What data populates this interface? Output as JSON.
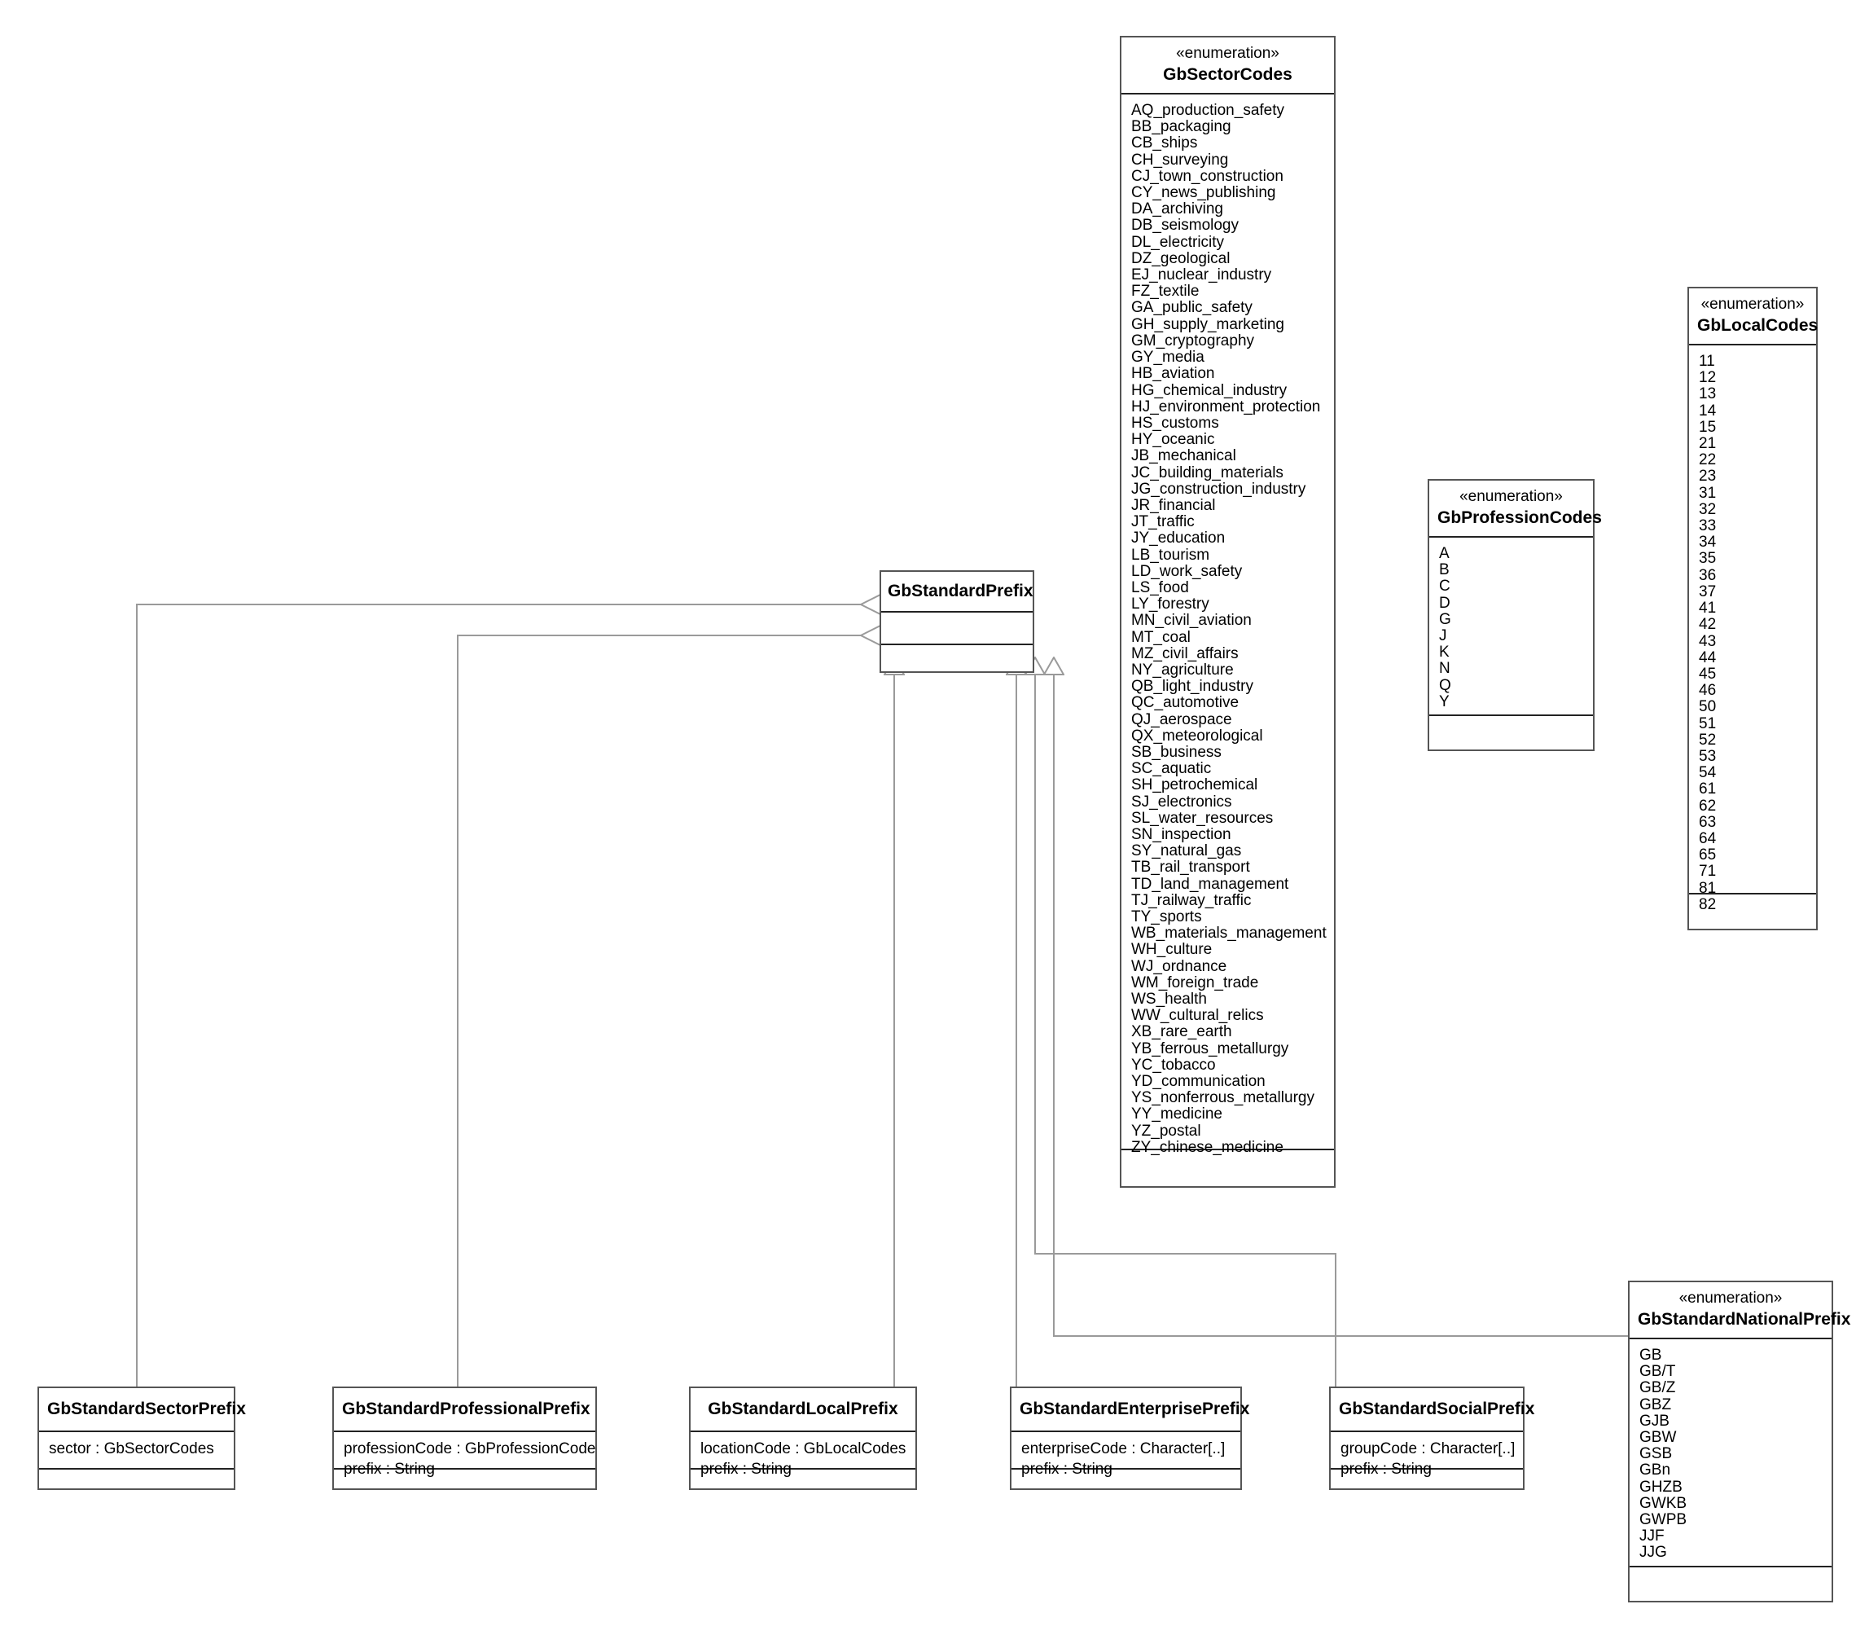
{
  "diagram": {
    "title": "GB Standard Prefix UML class diagram",
    "stereotype_label": "«enumeration»",
    "line_color": "#9a9a9a",
    "border_color": "#555555"
  },
  "enumerations": {
    "sector_codes": {
      "stereotype": "«enumeration»",
      "name": "GbSectorCodes",
      "literals": [
        "AQ_production_safety",
        "BB_packaging",
        "CB_ships",
        "CH_surveying",
        "CJ_town_construction",
        "CY_news_publishing",
        "DA_archiving",
        "DB_seismology",
        "DL_electricity",
        "DZ_geological",
        "EJ_nuclear_industry",
        "FZ_textile",
        "GA_public_safety",
        "GH_supply_marketing",
        "GM_cryptography",
        "GY_media",
        "HB_aviation",
        "HG_chemical_industry",
        "HJ_environment_protection",
        "HS_customs",
        "HY_oceanic",
        "JB_mechanical",
        "JC_building_materials",
        "JG_construction_industry",
        "JR_financial",
        "JT_traffic",
        "JY_education",
        "LB_tourism",
        "LD_work_safety",
        "LS_food",
        "LY_forestry",
        "MN_civil_aviation",
        "MT_coal",
        "MZ_civil_affairs",
        "NY_agriculture",
        "QB_light_industry",
        "QC_automotive",
        "QJ_aerospace",
        "QX_meteorological",
        "SB_business",
        "SC_aquatic",
        "SH_petrochemical",
        "SJ_electronics",
        "SL_water_resources",
        "SN_inspection",
        "SY_natural_gas",
        "TB_rail_transport",
        "TD_land_management",
        "TJ_railway_traffic",
        "TY_sports",
        "WB_materials_management",
        "WH_culture",
        "WJ_ordnance",
        "WM_foreign_trade",
        "WS_health",
        "WW_cultural_relics",
        "XB_rare_earth",
        "YB_ferrous_metallurgy",
        "YC_tobacco",
        "YD_communication",
        "YS_nonferrous_metallurgy",
        "YY_medicine",
        "YZ_postal",
        "ZY_chinese_medicine"
      ]
    },
    "local_codes": {
      "stereotype": "«enumeration»",
      "name": "GbLocalCodes",
      "literals": [
        "11",
        "12",
        "13",
        "14",
        "15",
        "21",
        "22",
        "23",
        "31",
        "32",
        "33",
        "34",
        "35",
        "36",
        "37",
        "41",
        "42",
        "43",
        "44",
        "45",
        "46",
        "50",
        "51",
        "52",
        "53",
        "54",
        "61",
        "62",
        "63",
        "64",
        "65",
        "71",
        "81",
        "82"
      ]
    },
    "profession_codes": {
      "stereotype": "«enumeration»",
      "name": "GbProfessionCodes",
      "literals": [
        "A",
        "B",
        "C",
        "D",
        "G",
        "J",
        "K",
        "N",
        "Q",
        "Y"
      ]
    },
    "national_prefix": {
      "stereotype": "«enumeration»",
      "name": "GbStandardNationalPrefix",
      "literals": [
        "GB",
        "GB/T",
        "GB/Z",
        "GBZ",
        "GJB",
        "GBW",
        "GSB",
        "GBn",
        "GHZB",
        "GWKB",
        "GWPB",
        "JJF",
        "JJG"
      ]
    }
  },
  "classes": {
    "standard_prefix": {
      "name": "GbStandardPrefix",
      "attributes": []
    },
    "sector_prefix": {
      "name": "GbStandardSectorPrefix",
      "attributes": [
        "sector : GbSectorCodes"
      ]
    },
    "professional_prefix": {
      "name": "GbStandardProfessionalPrefix",
      "attributes": [
        "professionCode : GbProfessionCode",
        "prefix : String"
      ]
    },
    "local_prefix": {
      "name": "GbStandardLocalPrefix",
      "attributes": [
        "locationCode : GbLocalCodes",
        "prefix : String"
      ]
    },
    "enterprise_prefix": {
      "name": "GbStandardEnterprisePrefix",
      "attributes": [
        "enterpriseCode : Character[..]",
        "prefix : String"
      ]
    },
    "social_prefix": {
      "name": "GbStandardSocialPrefix",
      "attributes": [
        "groupCode : Character[..]",
        "prefix : String"
      ]
    }
  }
}
